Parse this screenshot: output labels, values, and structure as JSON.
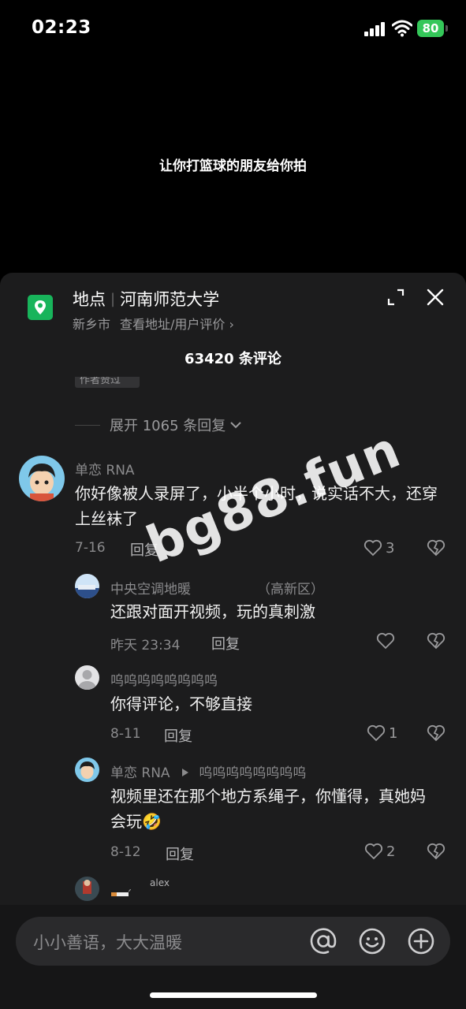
{
  "status": {
    "time": "02:23",
    "battery": "80"
  },
  "video": {
    "caption": "让你打篮球的朋友给你拍"
  },
  "sheet": {
    "location_label": "地点",
    "location_name": "河南师范大学",
    "city": "新乡市",
    "detail_link": "查看地址/用户评价 ›",
    "comment_count": "63420 条评论",
    "author_badge": "作者赞过",
    "expand_replies": "展开 1065 条回复"
  },
  "comments": [
    {
      "user": "单恋 RNA",
      "text": "你好像被人录屏了，小半个小时，说实话不大，还穿上丝袜了",
      "date": "7-16",
      "reply": "回复",
      "likes": "3"
    }
  ],
  "replies": [
    {
      "user": "中央空调地暖",
      "user_suffix": "（高新区）",
      "text": "还跟对面开视频，玩的真刺激",
      "date": "昨天 23:34",
      "reply": "回复",
      "likes": ""
    },
    {
      "user": "呜呜呜呜呜呜呜呜",
      "text": "你得评论，不够直接",
      "date": "8-11",
      "reply": "回复",
      "likes": "1"
    },
    {
      "user": "单恋 RNA",
      "reply_to": "呜呜呜呜呜呜呜呜",
      "text": "视频里还在那个地方系绳子，你懂得，真她妈会玩🤣",
      "date": "8-12",
      "reply": "回复",
      "likes": "2"
    },
    {
      "user": "alex"
    }
  ],
  "watermark": "bg88.fun",
  "input": {
    "placeholder": "小小善语，大大温暖"
  },
  "colors": {
    "location_green": "#18b45b",
    "sheet_bg": "#1c1c1d",
    "battery_green": "#34c759"
  }
}
